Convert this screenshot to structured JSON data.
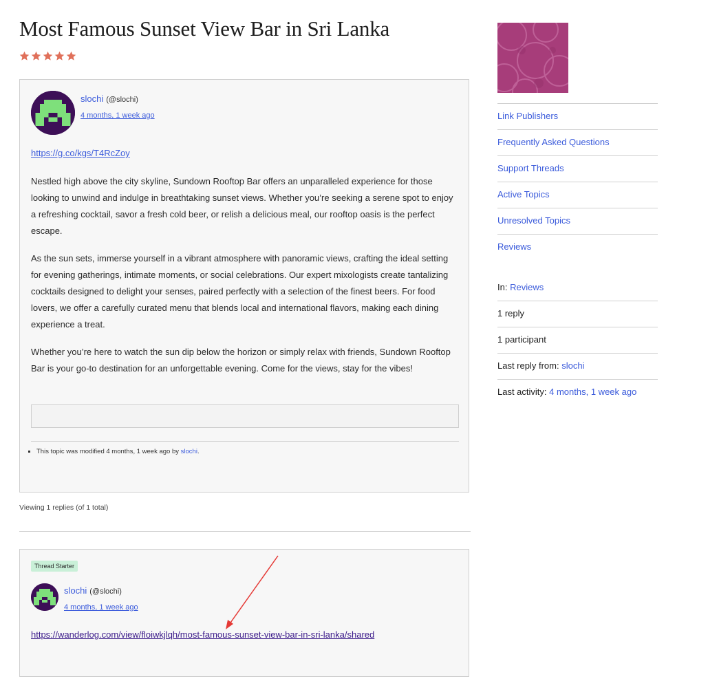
{
  "topic": {
    "title": "Most Famous Sunset View Bar in Sri Lanka",
    "rating": 5
  },
  "post": {
    "author_name": "slochi",
    "author_handle": "(@slochi)",
    "time": "4 months, 1 week ago",
    "link": "https://g.co/kgs/T4RcZoy",
    "paragraphs": [
      "Nestled high above the city skyline, Sundown Rooftop Bar offers an unparalleled experience for those looking to unwind and indulge in breathtaking sunset views. Whether you’re seeking a serene spot to enjoy a refreshing cocktail, savor a fresh cold beer, or relish a delicious meal, our rooftop oasis is the perfect escape.",
      "As the sun sets, immerse yourself in a vibrant atmosphere with panoramic views, crafting the ideal setting for evening gatherings, intimate moments, or social celebrations. Our expert mixologists create tantalizing cocktails designed to delight your senses, paired perfectly with a selection of the finest beers. For food lovers, we offer a carefully curated menu that blends local and international flavors, making each dining experience a treat.",
      "Whether you’re here to watch the sun dip below the horizon or simply relax with friends, Sundown Rooftop Bar is your go-to destination for an unforgettable evening. Come for the views, stay for the vibes!"
    ],
    "modified_text": "This topic was modified 4 months, 1 week ago by ",
    "modified_by": "slochi",
    "modified_suffix": "."
  },
  "viewing_text": "Viewing 1 replies (of 1 total)",
  "reply": {
    "badge": "Thread Starter",
    "author_name": "slochi",
    "author_handle": "(@slochi)",
    "time": "4 months, 1 week ago",
    "link": "https://wanderlog.com/view/floiwkjlqh/most-famous-sunset-view-bar-in-sri-lanka/shared"
  },
  "sidebar": {
    "nav": [
      "Link Publishers",
      "Frequently Asked Questions",
      "Support Threads",
      "Active Topics",
      "Unresolved Topics",
      "Reviews"
    ],
    "info": {
      "in_label": "In: ",
      "in_value": "Reviews",
      "replies": "1 reply",
      "participants": "1 participant",
      "last_reply_label": "Last reply from: ",
      "last_reply_value": "slochi",
      "last_activity_label": "Last activity: ",
      "last_activity_value": "4 months, 1 week ago"
    }
  },
  "colors": {
    "star": "#e0705a",
    "link": "#3b5bdb",
    "avatar_bg": "#3d0f57",
    "avatar_fg": "#7ee07b",
    "badge_bg": "#c9f0d8",
    "annotation_arrow": "#e53935"
  }
}
